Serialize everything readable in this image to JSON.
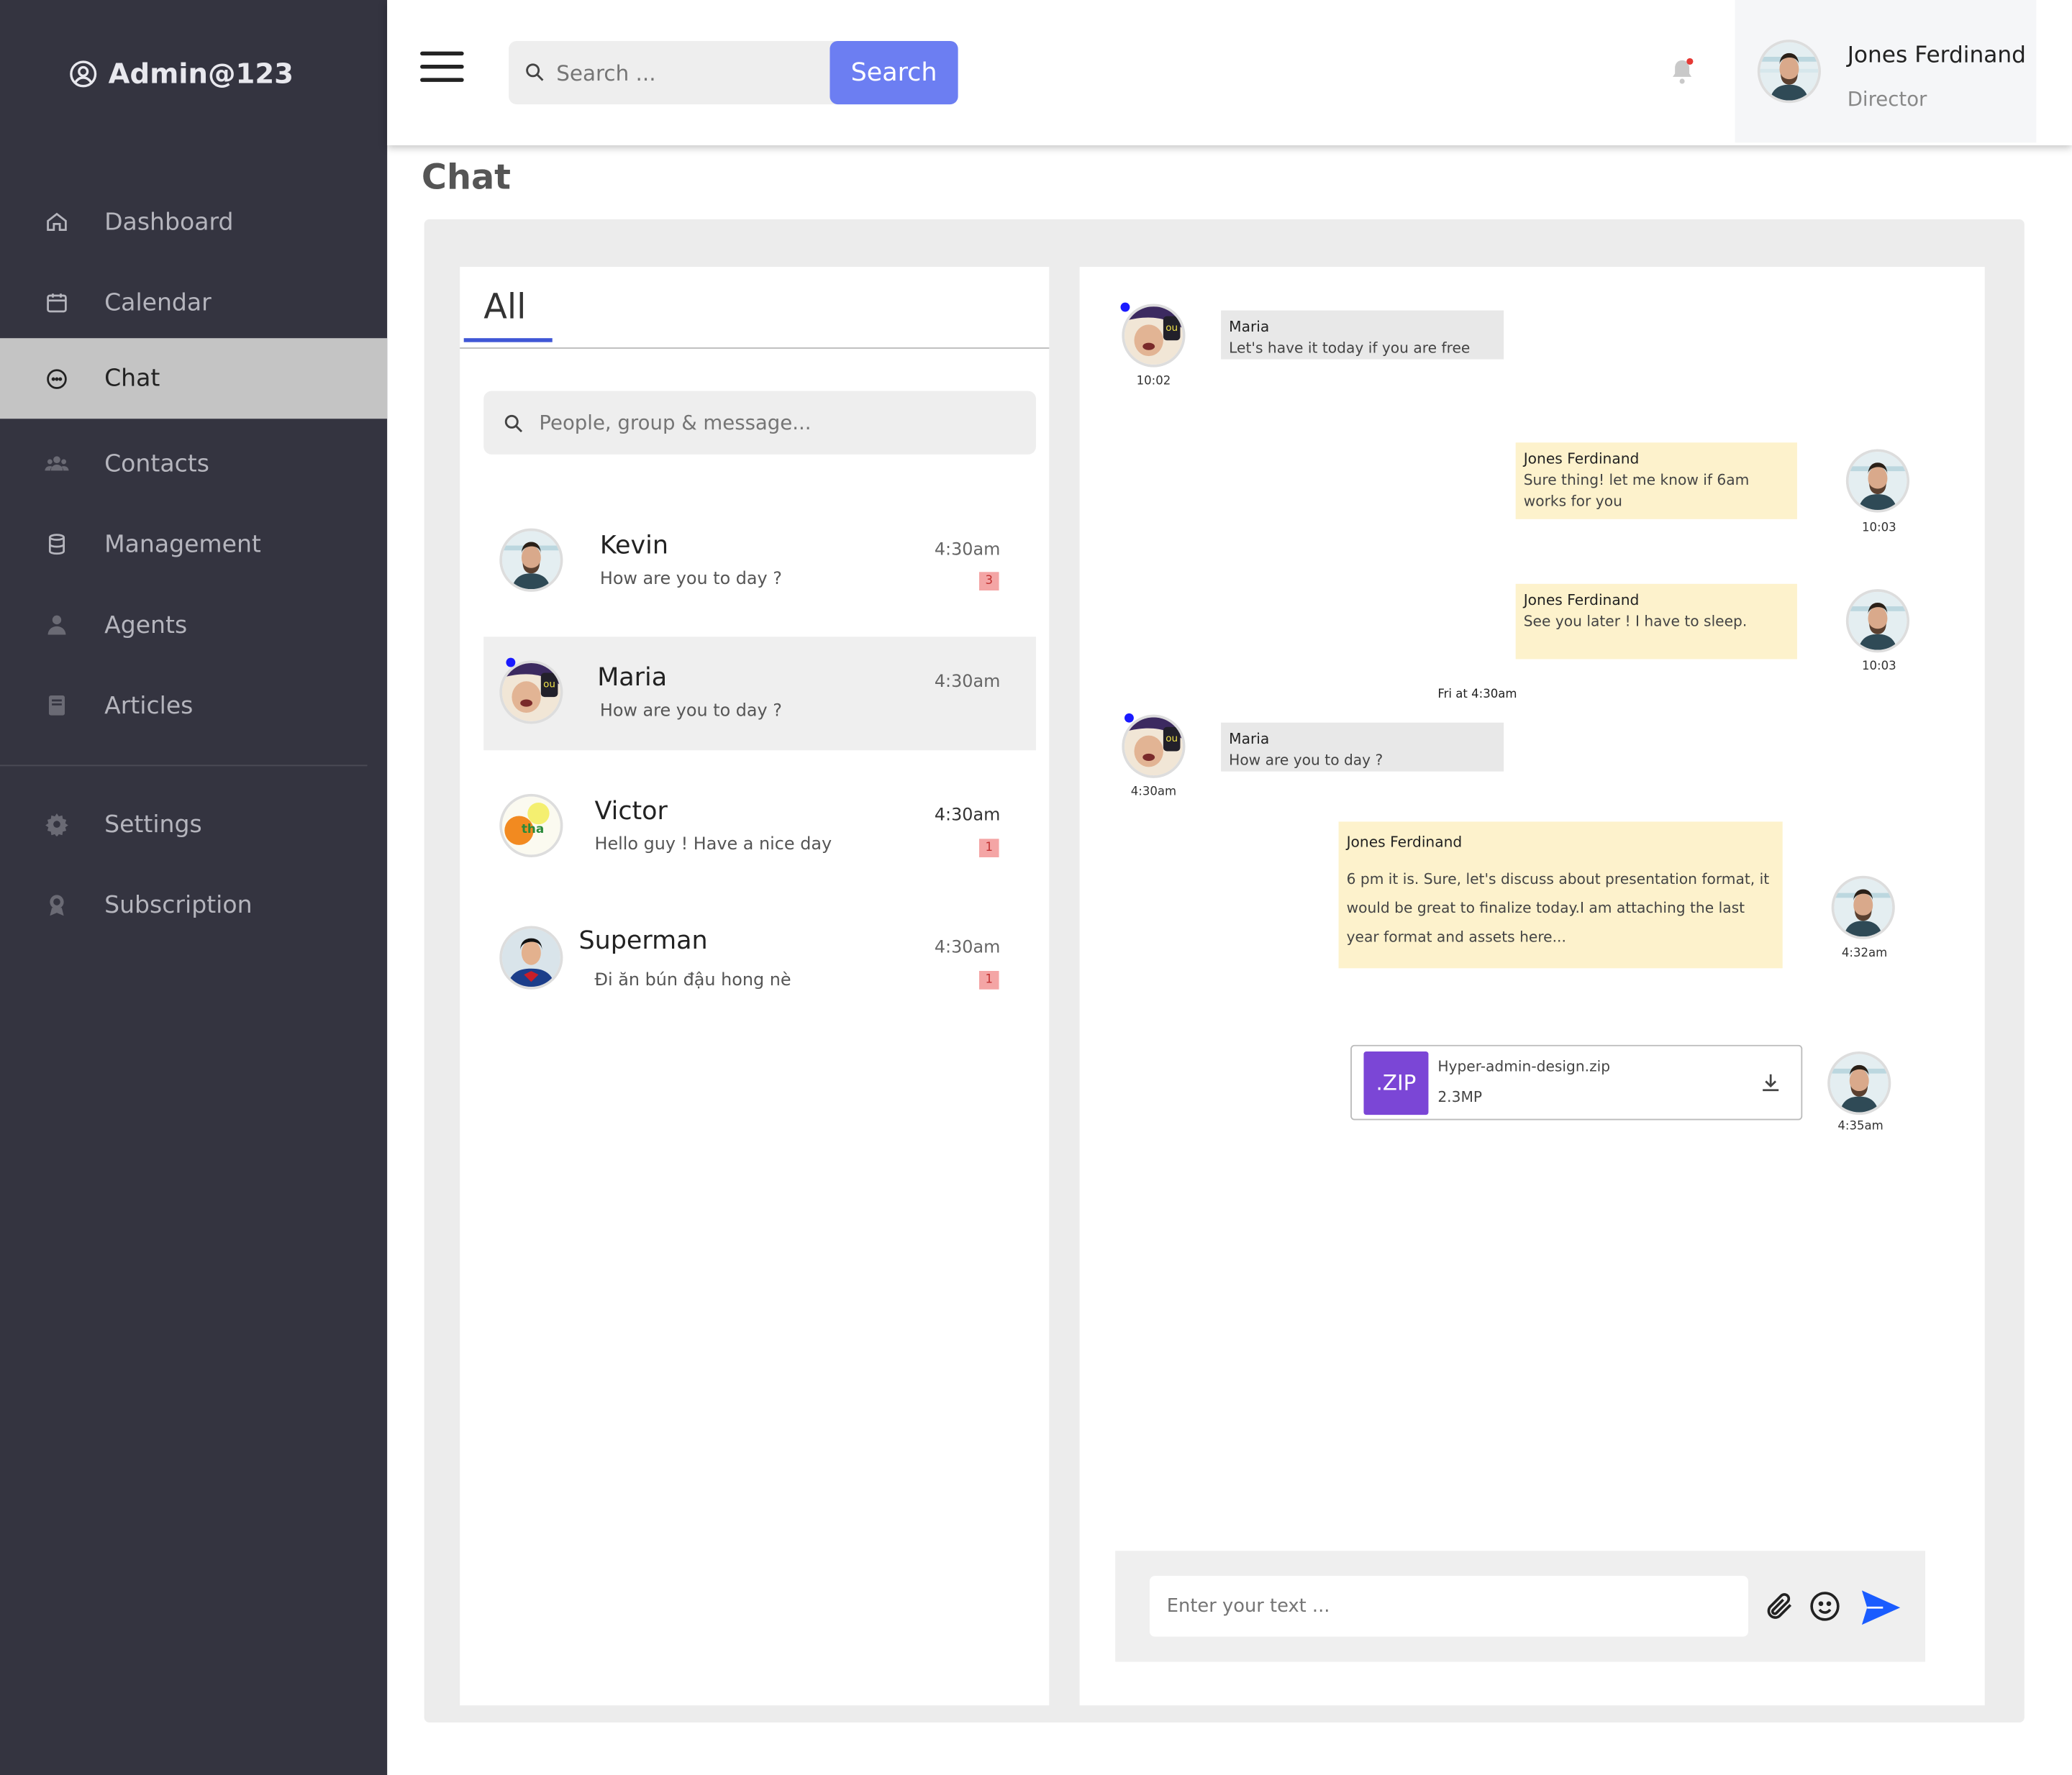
{
  "brand": {
    "label": "Admin@123"
  },
  "sidebar": {
    "items": [
      {
        "label": "Dashboard",
        "icon": "home-icon"
      },
      {
        "label": "Calendar",
        "icon": "calendar-icon"
      },
      {
        "label": "Chat",
        "icon": "chat-icon",
        "active": true
      },
      {
        "label": "Contacts",
        "icon": "users-icon"
      },
      {
        "label": "Management",
        "icon": "database-icon"
      },
      {
        "label": "Agents",
        "icon": "agent-icon"
      },
      {
        "label": "Articles",
        "icon": "book-icon"
      },
      {
        "label": "Settings",
        "icon": "gear-icon"
      },
      {
        "label": "Subscription",
        "icon": "badge-icon"
      }
    ]
  },
  "topbar": {
    "search_placeholder": "Search ...",
    "search_button": "Search",
    "user": {
      "name": "Jones Ferdinand",
      "role": "Director"
    }
  },
  "page": {
    "title": "Chat"
  },
  "conversations": {
    "tab": "All",
    "search_placeholder": "People, group & message...",
    "items": [
      {
        "name": "Kevin",
        "message": "How are you to day ?",
        "time": "4:30am",
        "badge": "3"
      },
      {
        "name": "Maria",
        "message": "How are you to day ?",
        "time": "4:30am",
        "badge": ""
      },
      {
        "name": "Victor",
        "message": "Hello guy ! Have a nice day",
        "time": "4:30am",
        "badge": "1"
      },
      {
        "name": "Superman",
        "message": "Đi ăn bún đậu hong nè",
        "time": "4:30am",
        "badge": "1"
      }
    ]
  },
  "messages": {
    "m1": {
      "from": "Maria",
      "text": "Let's have it today if you are free",
      "time": "10:02"
    },
    "m2": {
      "from": "Jones Ferdinand",
      "text": "Sure thing! let me know if 6am works for you",
      "time": "10:03"
    },
    "m3": {
      "from": "Jones Ferdinand",
      "text": "See you later ! I have to sleep.",
      "time": "10:03"
    },
    "day_separator": "Fri at 4:30am",
    "m4": {
      "from": "Maria",
      "text": "How are you to day ?",
      "time": "4:30am"
    },
    "m5": {
      "from": "Jones Ferdinand",
      "text": "6 pm it is. Sure, let's discuss about presentation format, it would be great to finalize today.I am attaching the last year format and assets here...",
      "time": "4:32am"
    },
    "file": {
      "badge": ".ZIP",
      "name": "Hyper-admin-design.zip",
      "size": "2.3MP",
      "time": "4:35am"
    }
  },
  "composer": {
    "placeholder": "Enter your text ..."
  },
  "colors": {
    "sidebar_bg": "#343440",
    "accent": "#6c7ef2",
    "tab_underline": "#3f56d6",
    "zip_badge": "#7b46d6",
    "outgoing_bubble": "#fdf2cc",
    "incoming_bubble": "#e8e8e8",
    "send_icon": "#1a5cff"
  }
}
